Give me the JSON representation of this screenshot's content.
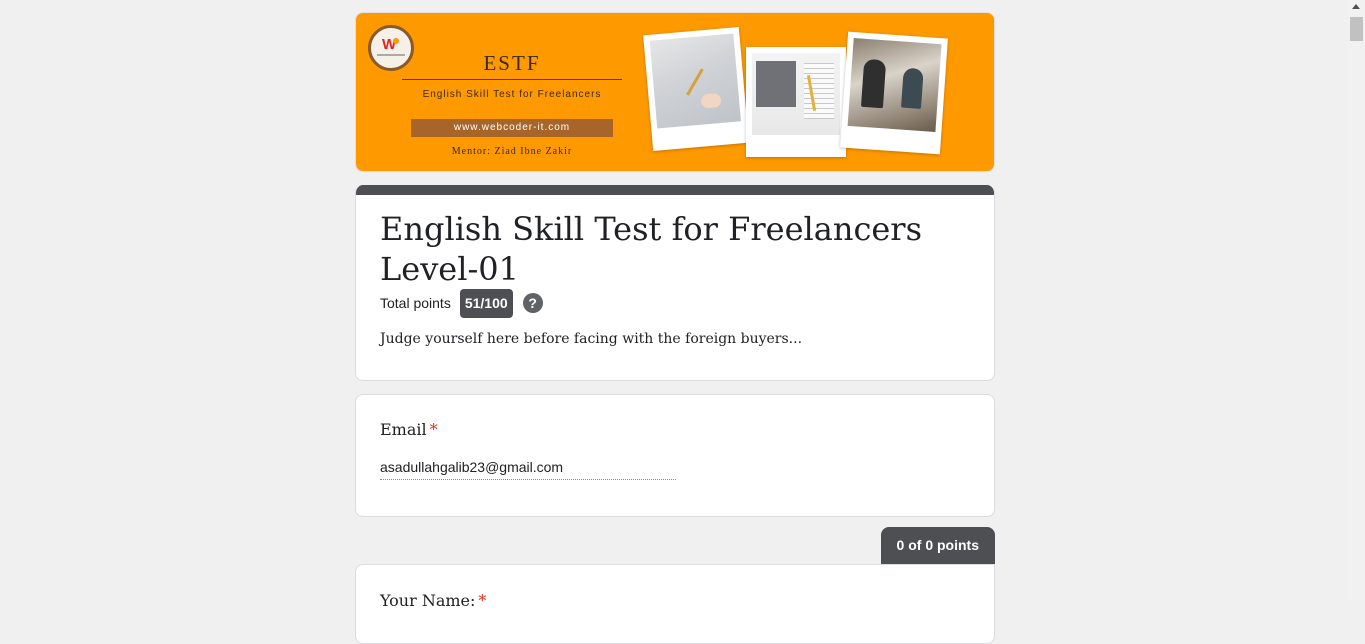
{
  "banner": {
    "title": "ESTF",
    "subtitle": "English Skill Test for Freelancers",
    "url": "www.webcoder-it.com",
    "mentor": "Mentor: Ziad Ibne Zakir",
    "logo_letter": "W"
  },
  "form": {
    "title": "English Skill Test for Freelancers Level-01",
    "points_label": "Total points",
    "points_value": "51/100",
    "help": "?",
    "description": "Judge yourself here before facing with the foreign buyers..."
  },
  "email": {
    "label": "Email",
    "required_mark": "*",
    "value": "asadullahgalib23@gmail.com"
  },
  "section": {
    "points": "0 of 0 points"
  },
  "name_question": {
    "label": "Your Name:",
    "required_mark": "*"
  },
  "colors": {
    "banner_bg": "#ff9900",
    "accent_gray": "#4d4f53",
    "required_red": "#d93025"
  }
}
